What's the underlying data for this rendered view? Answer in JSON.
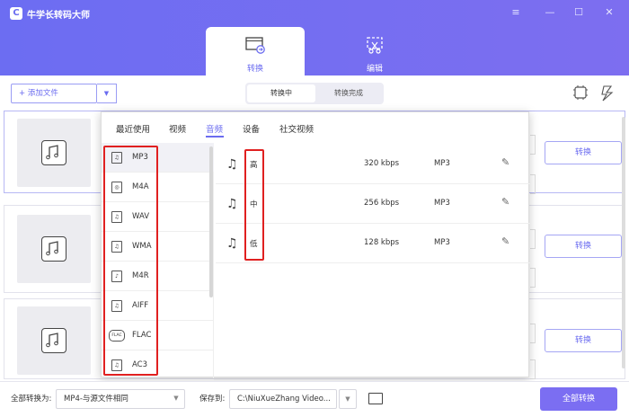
{
  "app": {
    "title": "牛学长转码大师",
    "logo_text": "C"
  },
  "window_controls": [
    "≡",
    "—",
    "☐",
    "✕"
  ],
  "top_tabs": [
    {
      "label": "转换",
      "active": true,
      "icon": "film-convert-icon"
    },
    {
      "label": "编辑",
      "active": false,
      "icon": "edit-cut-icon"
    }
  ],
  "toolbar": {
    "add_file": "+ 添加文件",
    "segments": [
      "转换中",
      "转换完成"
    ],
    "hw_accel_icon": "gpu-on-icon",
    "speed_icon": "speed-off-icon",
    "hw_label": "on",
    "speed_label": "off"
  },
  "card_convert_label": "转换",
  "popup": {
    "tabs": [
      "最近使用",
      "视频",
      "音频",
      "设备",
      "社交视频"
    ],
    "active_tab": "音频",
    "formats": [
      {
        "label": "MP3",
        "icon": "♫",
        "selected": true
      },
      {
        "label": "M4A",
        "icon": "◎"
      },
      {
        "label": "WAV",
        "icon": "♫"
      },
      {
        "label": "WMA",
        "icon": "♫"
      },
      {
        "label": "M4R",
        "icon": "♪"
      },
      {
        "label": "AIFF",
        "icon": "♫"
      },
      {
        "label": "FLAC",
        "icon": "FLAC"
      },
      {
        "label": "AC3",
        "icon": "♫"
      }
    ],
    "qualities": [
      {
        "name": "高",
        "bitrate": "320 kbps",
        "format": "MP3"
      },
      {
        "name": "中",
        "bitrate": "256 kbps",
        "format": "MP3"
      },
      {
        "name": "低",
        "bitrate": "128 kbps",
        "format": "MP3"
      }
    ]
  },
  "bottom": {
    "convert_all_to_label": "全部转换为:",
    "convert_all_to_value": "MP4-与源文件相同",
    "save_to_label": "保存到:",
    "save_to_value": "C:\\NiuXueZhang Video...",
    "convert_all_button": "全部转换"
  },
  "colors": {
    "accent": "#6b6cf0",
    "highlight": "#e02020"
  }
}
